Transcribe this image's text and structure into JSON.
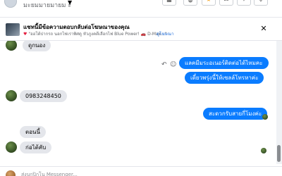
{
  "header": {
    "page_name": "มะยมมายมายม ะ",
    "caret": "▼",
    "buttons": [
      {
        "name": "inbox-icon",
        "glyph": "▦"
      },
      {
        "name": "trash-icon",
        "glyph": "🗑"
      },
      {
        "name": "flag-icon",
        "glyph": "★"
      },
      {
        "name": "mail-icon",
        "glyph": "✉"
      },
      {
        "name": "label-icon",
        "glyph": "✧"
      },
      {
        "name": "more-icon",
        "glyph": "⌄"
      }
    ],
    "flag_color": "#f5a623"
  },
  "notice": {
    "title": "แชทนี้มีข้อความตอบกลับต่อโฆษณาของคุณ",
    "subtitle": "\"ออโต้ปากรถ นอกไฟเราพิศดู หัวภูงคตีเลือกไฟ Blue Power! 🚗 D-Max...\"",
    "heart": "♥",
    "link": "ดูโฆษณา",
    "close": "✕"
  },
  "messages": {
    "m1": "ดูกนอง",
    "m2": "แลคมีมระอเนอร์ติดต่อได้ไหมคะ",
    "m3": "เดี๋ยวพรุ่งนี้ให้เซลล์โทรหาค่ะ",
    "m4": "0983248450",
    "m5": "สะดวกรับสายกี่โมงค่ะ",
    "m6": "ตอนนี้",
    "m7": "ก่อไต้คับ"
  },
  "icons": {
    "reply": "↶",
    "react": "☺"
  },
  "composer": {
    "placeholder": "ส่งบกปิกโน Messenger..."
  },
  "colors": {
    "outgoing": "#0a7cff",
    "incoming": "#e4e6eb",
    "link": "#216fdb"
  }
}
